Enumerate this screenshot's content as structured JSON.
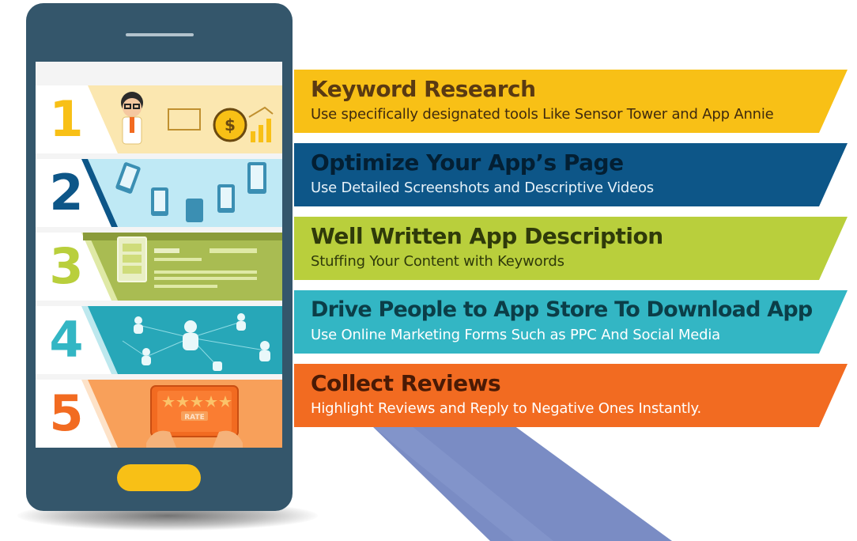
{
  "colors": {
    "yellow": "#f8c016",
    "blue": "#0d5688",
    "green": "#b9cf3c",
    "teal": "#33b6c4",
    "orange": "#f26b21",
    "phone": "#34566b",
    "beam": "#7a8cc4"
  },
  "steps": [
    {
      "number": "1",
      "title": "Keyword Research",
      "description": "Use specifically designated tools Like Sensor Tower and App Annie",
      "icon": "keyword-research-illustration"
    },
    {
      "number": "2",
      "title": "Optimize Your App’s Page",
      "description": "Use Detailed Screenshots and Descriptive Videos",
      "icon": "smartphones-illustration"
    },
    {
      "number": "3",
      "title": "Well Written App Description",
      "description": "Stuffing Your Content with Keywords",
      "icon": "app-description-illustration"
    },
    {
      "number": "4",
      "title": "Drive People to App Store To Download App",
      "description": "Use Online Marketing Forms Such as PPC And Social Media",
      "icon": "network-people-illustration"
    },
    {
      "number": "5",
      "title": "Collect Reviews",
      "description": "Highlight Reviews and Reply to Negative Ones Instantly.",
      "icon": "rating-tablet-illustration"
    }
  ],
  "rating_label": "RATE"
}
